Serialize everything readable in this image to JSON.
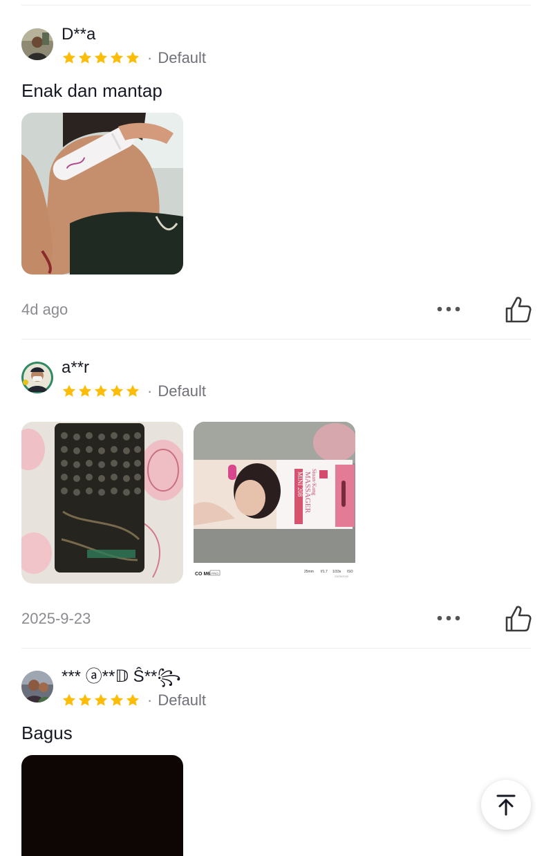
{
  "reviews": [
    {
      "username": "D**a",
      "rating": 5,
      "variant": "Default",
      "text": "Enak dan mantap",
      "time": "4d ago",
      "photos": [
        "face-massager-selfie"
      ]
    },
    {
      "username": "a**r",
      "rating": 5,
      "variant": "Default",
      "text": "",
      "time": "2025-9-23",
      "photos": [
        "bubble-wrap-package",
        "mini-massager-box"
      ],
      "photo2": {
        "box_brand": "Siuan·Kang",
        "box_line1": "MINI 208",
        "box_line2": "MASSAGER",
        "camera_label": "CO M6",
        "camera_tag": "PRO",
        "exif_left": "25mm",
        "exif_mid": "f/1.7",
        "exif_shutter": "1/33s",
        "exif_iso": "ISO",
        "exif_date": "23/09/2025"
      }
    },
    {
      "username": "*** ⓐ**𝔻 Ŝ**",
      "username_deco": "꧂",
      "rating": 5,
      "variant": "Default",
      "text": "Bagus",
      "photos": [
        "dark-photo"
      ]
    }
  ],
  "separator": "·",
  "colors": {
    "star": "#fbbd08",
    "text": "#161823",
    "muted": "#8a8b91",
    "divider": "#ececec"
  },
  "icons": {
    "more": "more-dots-icon",
    "like": "thumbs-up-icon",
    "scroll_top": "arrow-up-to-top-icon"
  }
}
